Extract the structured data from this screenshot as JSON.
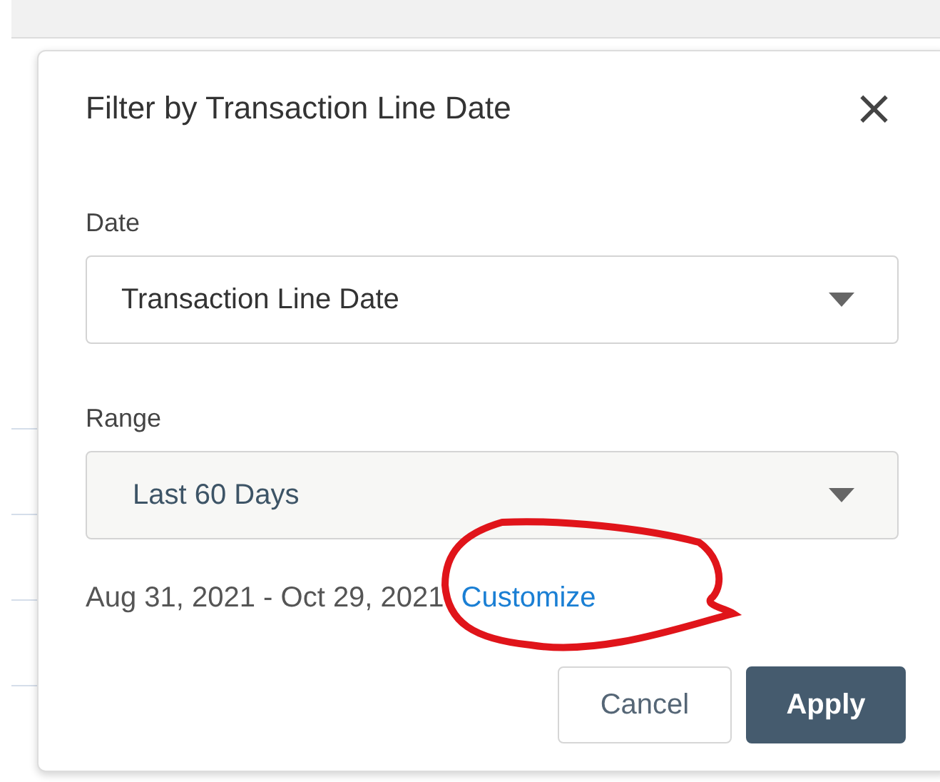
{
  "dialog": {
    "title": "Filter by Transaction Line Date",
    "close": "×",
    "fields": [
      {
        "label": "Date",
        "value": "Transaction Line Date",
        "kind": "select",
        "filled": false
      },
      {
        "label": "Range",
        "value": "Last 60 Days",
        "kind": "select",
        "filled": true
      }
    ],
    "range_text": "Aug 31, 2021 - Oct 29, 2021",
    "customize_link": "Customize",
    "buttons": [
      {
        "label": "Cancel",
        "kind": "secondary"
      },
      {
        "label": "Apply",
        "kind": "primary"
      }
    ]
  },
  "annotation": {
    "kind": "circle",
    "color": "#e0141a"
  }
}
